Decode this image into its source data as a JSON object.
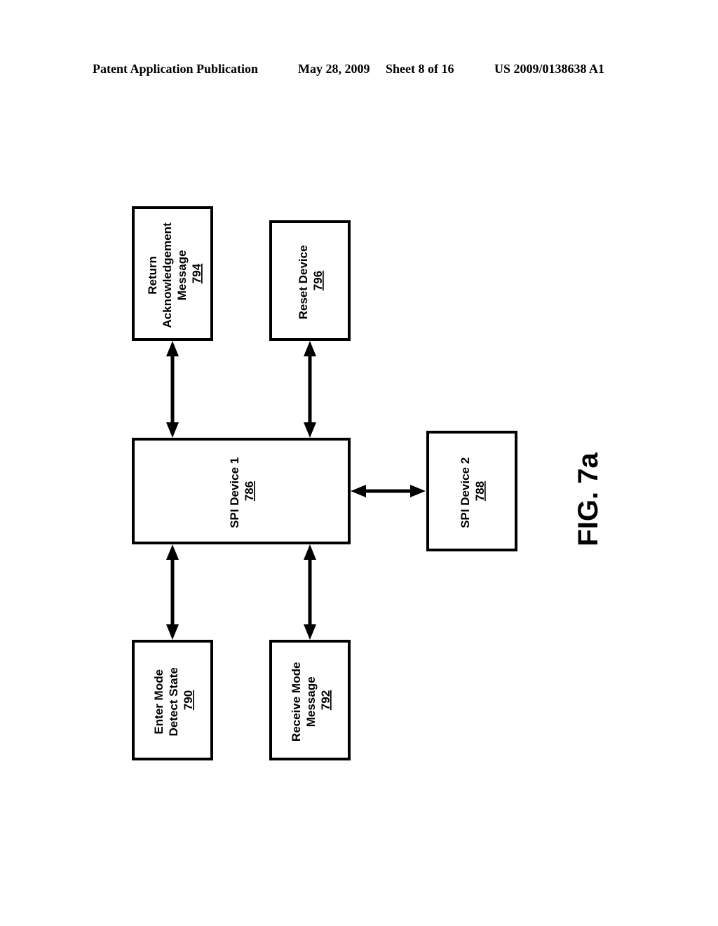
{
  "header": {
    "publication": "Patent Application Publication",
    "date": "May 28, 2009",
    "sheet": "Sheet 8 of 16",
    "number": "US 2009/0138638 A1"
  },
  "figure": {
    "label": "FIG. 7a",
    "text_orientation": "rotated 90° counter-clockwise"
  },
  "blocks": {
    "return_ack": {
      "lines": [
        "Return",
        "Acknowledgement",
        "Message"
      ],
      "ref": "794"
    },
    "reset_device": {
      "lines": [
        "Reset Device"
      ],
      "ref": "796"
    },
    "spi_device_1": {
      "lines": [
        "SPI Device 1"
      ],
      "ref": "786"
    },
    "spi_device_2": {
      "lines": [
        "SPI Device 2"
      ],
      "ref": "788"
    },
    "enter_mode": {
      "lines": [
        "Enter Mode",
        "Detect State"
      ],
      "ref": "790"
    },
    "receive_mode": {
      "lines": [
        "Receive Mode",
        "Message"
      ],
      "ref": "792"
    }
  },
  "connections": [
    {
      "from": "spi_device_1",
      "to": "return_ack",
      "type": "bidirectional"
    },
    {
      "from": "spi_device_1",
      "to": "reset_device",
      "type": "bidirectional"
    },
    {
      "from": "spi_device_1",
      "to": "spi_device_2",
      "type": "bidirectional"
    },
    {
      "from": "spi_device_1",
      "to": "enter_mode",
      "type": "bidirectional"
    },
    {
      "from": "spi_device_1",
      "to": "receive_mode",
      "type": "bidirectional"
    }
  ]
}
